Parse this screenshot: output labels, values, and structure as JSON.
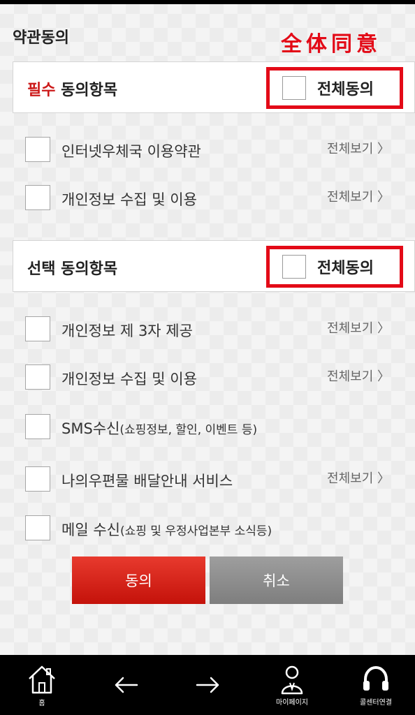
{
  "page": {
    "title": "약관동의",
    "annotation": "全体同意"
  },
  "required": {
    "title_accent": "필수",
    "title_rest": " 동의항목",
    "agree_all_label": "전체동의",
    "items": [
      {
        "label": "인터넷우체국 이용약관",
        "sub": "",
        "view": "전체보기 〉"
      },
      {
        "label": "개인정보 수집 및 이용",
        "sub": "",
        "view": "전체보기 〉"
      }
    ]
  },
  "optional": {
    "title": "선택 동의항목",
    "agree_all_label": "전체동의",
    "items": [
      {
        "label": "개인정보 제 3자 제공",
        "sub": "",
        "view": "전체보기 〉"
      },
      {
        "label": "개인정보 수집 및 이용",
        "sub": "",
        "view": "전체보기 〉"
      },
      {
        "label": "SMS수신",
        "sub": "(쇼핑정보, 할인, 이벤트 등)",
        "view": ""
      },
      {
        "label": "나의우편물 배달안내 서비스",
        "sub": "",
        "view": "전체보기 〉"
      },
      {
        "label": "메일 수신",
        "sub": "(쇼핑 및 우정사업본부 소식등)",
        "view": ""
      }
    ]
  },
  "buttons": {
    "agree": "동의",
    "cancel": "취소"
  },
  "nav": {
    "home_label": "홈",
    "mypage_label": "마이페이지",
    "callcenter_label": "콜센터연결",
    "icons": [
      "home-icon",
      "arrow-left-icon",
      "arrow-right-icon",
      "user-icon",
      "headset-icon"
    ]
  },
  "colors": {
    "accent": "#e30a17",
    "primary_button": "#d42218",
    "secondary_button": "#8c8c8c",
    "nav_bg": "#000000"
  }
}
